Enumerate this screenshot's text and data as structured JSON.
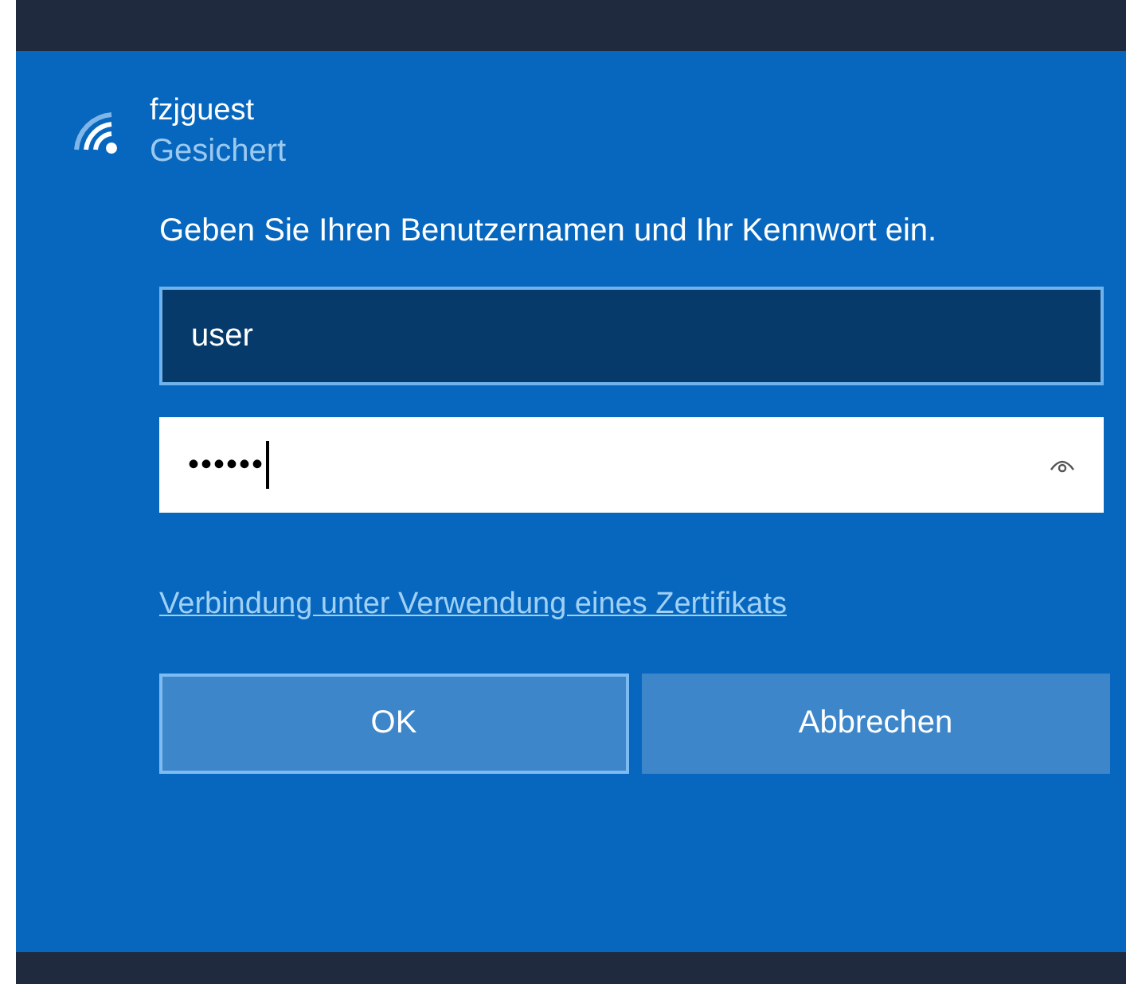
{
  "network": {
    "name": "fzjguest",
    "status": "Gesichert"
  },
  "prompt": "Geben Sie Ihren Benutzernamen und Ihr Kennwort ein.",
  "fields": [
    {
      "kind": "text",
      "value": "user",
      "focused": false
    },
    {
      "kind": "password",
      "value": "••••••",
      "focused": true
    }
  ],
  "link": "Verbindung unter Verwendung eines Zertifikats",
  "buttons": [
    {
      "label": "OK",
      "default": true
    },
    {
      "label": "Abbrechen",
      "default": false
    }
  ]
}
